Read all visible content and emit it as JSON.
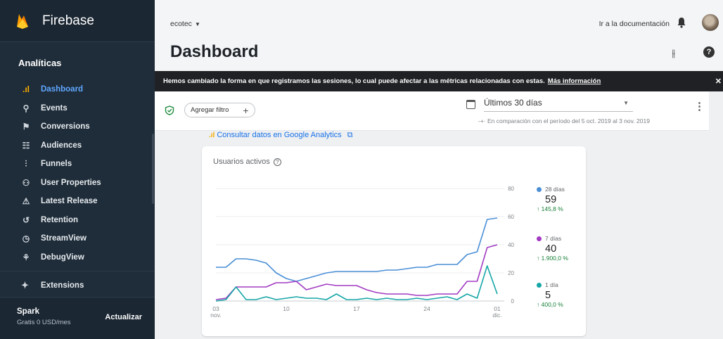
{
  "sidebar": {
    "brand": "Firebase",
    "section": "Analíticas",
    "items": [
      {
        "label": "Dashboard",
        "icon": "bar-chart-icon",
        "glyph": ".ıl",
        "active": true
      },
      {
        "label": "Events",
        "icon": "events-icon",
        "glyph": "⚲",
        "active": false
      },
      {
        "label": "Conversions",
        "icon": "flag-icon",
        "glyph": "⚑",
        "active": false
      },
      {
        "label": "Audiences",
        "icon": "audiences-icon",
        "glyph": "☷",
        "active": false
      },
      {
        "label": "Funnels",
        "icon": "funnels-icon",
        "glyph": "⫶",
        "active": false
      },
      {
        "label": "User Properties",
        "icon": "user-properties-icon",
        "glyph": "⚇",
        "active": false
      },
      {
        "label": "Latest Release",
        "icon": "latest-release-icon",
        "glyph": "⚠",
        "active": false
      },
      {
        "label": "Retention",
        "icon": "retention-icon",
        "glyph": "↺",
        "active": false
      },
      {
        "label": "StreamView",
        "icon": "streamview-icon",
        "glyph": "◷",
        "active": false
      },
      {
        "label": "DebugView",
        "icon": "debugview-icon",
        "glyph": "⚘",
        "active": false
      }
    ],
    "extensions": "Extensions",
    "plan": {
      "name": "Spark",
      "price": "Gratis 0 USD/mes",
      "upgrade": "Actualizar"
    }
  },
  "header": {
    "project": "ecotec",
    "doc_link": "Ir a la documentación",
    "title": "Dashboard"
  },
  "banner": {
    "text": "Hemos cambiado la forma en que registramos las sesiones, lo cual puede afectar a las métricas relacionadas con estas.",
    "link": "Más información"
  },
  "filterbar": {
    "add_filter": "Agregar filtro",
    "date_range": "Últimos 30 días",
    "comparison": "En comparación con el período del 5 oct. 2019 al 3 nov. 2019"
  },
  "ga_link": "Consultar datos en Google Analytics",
  "card": {
    "title": "Usuarios activos"
  },
  "colors": {
    "d28": "#4a8fd6",
    "d7": "#a23bc2",
    "d1": "#17a6a6",
    "accent": "#f9ab00",
    "link": "#1a73e8"
  },
  "chart_data": {
    "type": "line",
    "x": [
      "03 nov.",
      "04",
      "05",
      "06",
      "07",
      "08",
      "09",
      "10",
      "11",
      "12",
      "13",
      "14",
      "15",
      "16",
      "17",
      "18",
      "19",
      "20",
      "21",
      "22",
      "23",
      "24",
      "25",
      "26",
      "27",
      "28",
      "29",
      "30",
      "01 dic."
    ],
    "x_tick_labels": [
      {
        "index": 0,
        "line1": "03",
        "line2": "nov."
      },
      {
        "index": 7,
        "line1": "10",
        "line2": ""
      },
      {
        "index": 14,
        "line1": "17",
        "line2": ""
      },
      {
        "index": 21,
        "line1": "24",
        "line2": ""
      },
      {
        "index": 28,
        "line1": "01",
        "line2": "dic."
      }
    ],
    "ylim": [
      0,
      80
    ],
    "yticks": [
      0,
      20,
      40,
      60,
      80
    ],
    "series": [
      {
        "name": "28 días",
        "total": "59",
        "change": "145,8 %",
        "values": [
          24,
          24,
          30,
          30,
          29,
          27,
          20,
          16,
          14,
          16,
          18,
          20,
          21,
          21,
          21,
          21,
          21,
          22,
          22,
          23,
          24,
          24,
          26,
          26,
          26,
          33,
          35,
          58,
          59
        ]
      },
      {
        "name": "7 días",
        "total": "40",
        "change": "1.900,0 %",
        "values": [
          1,
          2,
          10,
          10,
          10,
          10,
          13,
          13,
          14,
          8,
          10,
          12,
          11,
          11,
          11,
          8,
          6,
          5,
          5,
          5,
          4,
          4,
          5,
          5,
          5,
          14,
          14,
          38,
          40
        ]
      },
      {
        "name": "1 día",
        "total": "5",
        "change": "400,0 %",
        "values": [
          0,
          1,
          10,
          1,
          1,
          3,
          1,
          2,
          3,
          2,
          2,
          1,
          5,
          1,
          1,
          2,
          1,
          2,
          1,
          1,
          2,
          1,
          2,
          3,
          1,
          5,
          2,
          25,
          5
        ]
      }
    ]
  }
}
